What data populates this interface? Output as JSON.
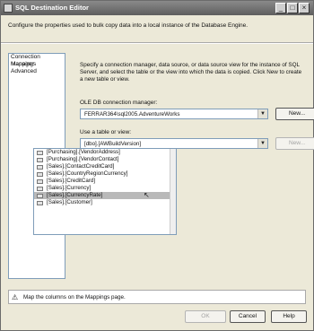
{
  "window": {
    "title": "SQL Destination Editor",
    "controls": {
      "minimize": "_",
      "maximize": "□",
      "close": "×"
    }
  },
  "description": "Configure the properties used to bulk copy data into a local instance of the Database Engine.",
  "nav": {
    "items": [
      "Connection Manager",
      "Mappings",
      "Advanced"
    ]
  },
  "main": {
    "intro": "Specify a connection manager, data source, or data source view for the instance of SQL Server, and select the table or the view into which the data is copied. Click New to create a new table or view.",
    "connection_label": "OLE DB connection manager:",
    "connection_value": "FERRAR364\\sql2005.AdventureWorks",
    "new_label": "New...",
    "table_label": "Use a table or view:",
    "table_value": "[dbo].[AWBuildVersion]",
    "table_new_label": "New...",
    "table_options": [
      "[Purchasing].[VendorAddress]",
      "[Purchasing].[VendorContact]",
      "[Sales].[ContactCreditCard]",
      "[Sales].[CountryRegionCurrency]",
      "[Sales].[CreditCard]",
      "[Sales].[Currency]",
      "[Sales].[CurrencyRate]",
      "[Sales].[Customer]"
    ]
  },
  "status": {
    "message": "Map the columns on the Mappings page."
  },
  "footer": {
    "ok": "OK",
    "cancel": "Cancel",
    "help": "Help"
  },
  "icons": {
    "dropdown": "▼",
    "warning": "⚠",
    "cursor": "↖"
  }
}
